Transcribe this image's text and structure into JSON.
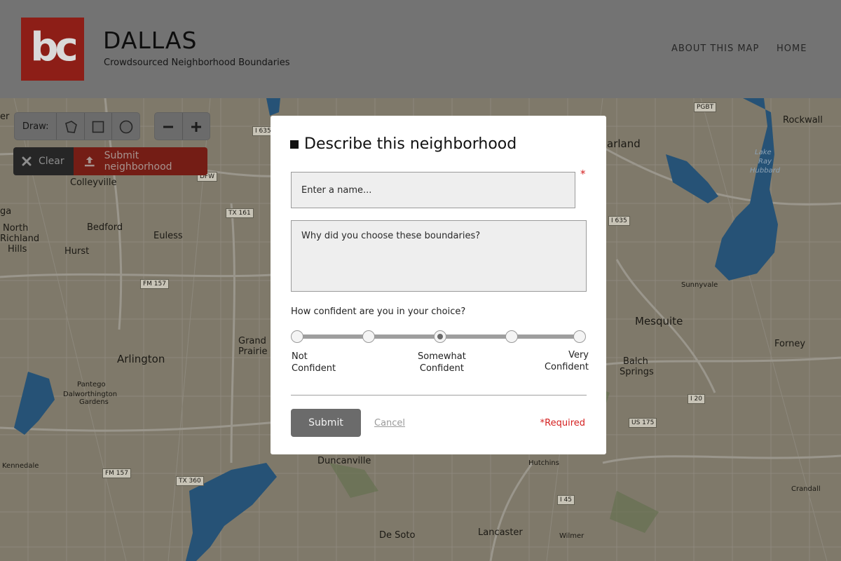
{
  "header": {
    "logo_text": "bc",
    "title": "DALLAS",
    "subtitle": "Crowdsourced Neighborhood Boundaries",
    "nav": [
      "ABOUT THIS MAP",
      "HOME"
    ],
    "brand_color": "#9a2119"
  },
  "toolbar": {
    "draw_label": "Draw:",
    "tools": [
      "polygon-icon",
      "rectangle-icon",
      "circle-icon"
    ],
    "zoom": [
      "minus-icon",
      "plus-icon"
    ],
    "clear_label": "Clear",
    "submit_label": "Submit neighborhood"
  },
  "map": {
    "places": [
      "Colleyville",
      "Bedford",
      "Euless",
      "North",
      "Richland",
      "Hills",
      "Hurst",
      "Arlington",
      "Grand",
      "Prairie",
      "Pantego",
      "Dalworthington",
      "Gardens",
      "Kennedale",
      "Duncanville",
      "De Soto",
      "Lancaster",
      "Hutchins",
      "Wilmer",
      "Crandall",
      "Forney",
      "Balch",
      "Springs",
      "Mesquite",
      "Sunnyvale",
      "Rockwall",
      "arland",
      "Lake",
      "Ray",
      "Hubbard",
      "ga",
      "er"
    ],
    "highways": [
      "I 635",
      "TX 161",
      "FM 157",
      "FM 157",
      "TX 360",
      "I 635",
      "PGBT",
      "I 20",
      "US 175",
      "I 45",
      "DFW"
    ]
  },
  "modal": {
    "title": "Describe this neighborhood",
    "name_placeholder": "Enter a name...",
    "required_marker": "*",
    "reason_placeholder": "Why did you choose these boundaries?",
    "confidence_question": "How confident are you in your choice?",
    "confidence_stops": 5,
    "confidence_selected": 3,
    "label_not_1": "Not",
    "label_not_2": "Confident",
    "label_somewhat_1": "Somewhat",
    "label_somewhat_2": "Confident",
    "label_very_1": "Very",
    "label_very_2": "Confident",
    "submit_label": "Submit",
    "cancel_label": "Cancel",
    "required_note": "*Required",
    "accent_color": "#d42020"
  }
}
